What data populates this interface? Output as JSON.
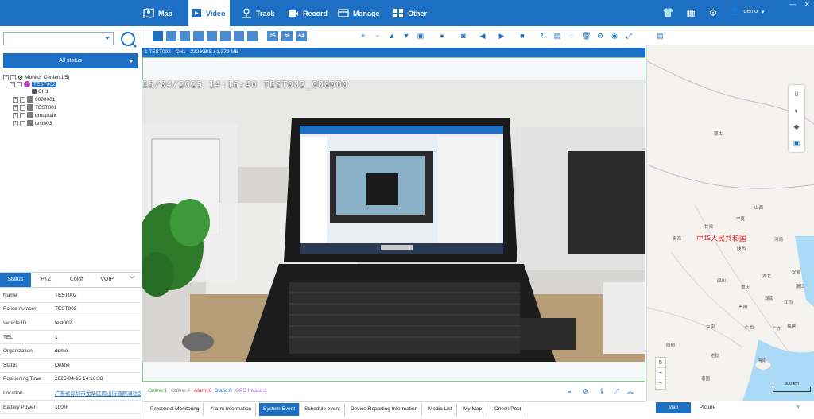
{
  "nav": {
    "items": [
      {
        "label": "Map",
        "icon": "map-icon"
      },
      {
        "label": "Video",
        "icon": "video-icon",
        "active": true
      },
      {
        "label": "Track",
        "icon": "track-icon"
      },
      {
        "label": "Record",
        "icon": "record-icon"
      },
      {
        "label": "Manage",
        "icon": "manage-icon"
      },
      {
        "label": "Other",
        "icon": "other-icon"
      }
    ],
    "user": "demo",
    "accent": "#1c6fc3"
  },
  "left": {
    "search_value": "",
    "status_filter": "All status",
    "tree": {
      "root": "Monitor Center(1/5)",
      "nodes": [
        "TEST002",
        "CH1",
        "0000001",
        "TEST001",
        "grouptalk",
        "test003"
      ]
    },
    "info_tabs": [
      "Status",
      "PTZ",
      "Color",
      "VOIP"
    ],
    "info": [
      {
        "key": "Name",
        "value": "TEST002"
      },
      {
        "key": "Police number",
        "value": "TEST002"
      },
      {
        "key": "Vehicle ID",
        "value": "test002"
      },
      {
        "key": "TEL",
        "value": "1"
      },
      {
        "key": "Organization",
        "value": "demo"
      },
      {
        "key": "Status",
        "value": "Online"
      },
      {
        "key": "Positioning Time",
        "value": "2025-04-15 14:16:38"
      },
      {
        "key": "Location",
        "value": "广东省深圳市龙华区观山街道观澜社区"
      },
      {
        "key": "Battery Power",
        "value": "100%"
      }
    ]
  },
  "video": {
    "layout_buttons": [
      "25",
      "36",
      "64"
    ],
    "title": "1  TEST002 - CH1 - 222 KB/S / 1.379 MB",
    "osd": "15/04/2025 14:16:40 TEST002_000000"
  },
  "status_bar": {
    "online": "Online:1",
    "offline": "Offline:4",
    "alarm": "Alarm:0",
    "static": "Static:0",
    "gps_invalid": "GPS Invalid:1"
  },
  "bottom_tabs": [
    "Personnel Monitoring",
    "Alarm Information",
    "System Event",
    "Schedule event",
    "Device Reporting Information",
    "Media List",
    "My Map",
    "Check Post"
  ],
  "map": {
    "labels": {
      "country": "中华人民共和国",
      "mongolia": "蒙古",
      "myanmar": "缅甸",
      "laos": "老挝",
      "thailand": "泰国",
      "hainan": "海南",
      "qinghai": "青海",
      "gansu": "甘肃",
      "sichuan": "四川",
      "yunnan": "云南",
      "guizhou": "贵州",
      "guangxi": "广西",
      "hubei": "湖北",
      "hunan": "湖南",
      "jiangxi": "江西",
      "fujian": "福建",
      "guangdong": "广东",
      "ningxia": "宁夏",
      "shaanxi": "陕西",
      "henan": "河南",
      "anhui": "安徽",
      "zhejiang": "浙江",
      "shanxi": "山西",
      "chongqing": "重庆"
    },
    "zoom_level": "5",
    "scale": "300 km",
    "tabs": [
      "Map",
      "Picture"
    ]
  }
}
